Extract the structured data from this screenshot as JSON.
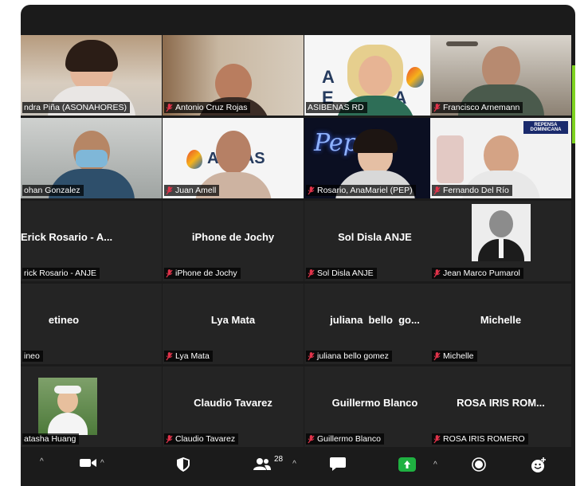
{
  "participants": [
    {
      "name": "ndra Piña (ASONAHORES)",
      "center": "",
      "video": true
    },
    {
      "name": "Antonio Cruz Rojas",
      "center": "",
      "video": true
    },
    {
      "name": "ASIBENAS RD",
      "center": "",
      "video": true
    },
    {
      "name": "Francisco Arnemann",
      "center": "",
      "video": true
    },
    {
      "name": "ohan Gonzalez",
      "center": "",
      "video": true
    },
    {
      "name": "Juan Amell",
      "center": "",
      "video": true
    },
    {
      "name": "Rosario, AnaMariel (PEP)",
      "center": "",
      "video": true
    },
    {
      "name": "Fernando Del Río",
      "center": "",
      "video": true
    },
    {
      "name": "rick Rosario - ANJE",
      "center": "Erick Rosario - A...",
      "video": false
    },
    {
      "name": "iPhone de Jochy",
      "center": "iPhone de Jochy",
      "video": false
    },
    {
      "name": "Sol Disla ANJE",
      "center": "Sol Disla ANJE",
      "video": false
    },
    {
      "name": "Jean Marco Pumarol",
      "center": "",
      "video": false
    },
    {
      "name": "ineo",
      "center": "etineo",
      "video": false
    },
    {
      "name": "Lya Mata",
      "center": "Lya Mata",
      "video": false
    },
    {
      "name": "juliana bello gomez",
      "center": "juliana  bello  go...",
      "video": false
    },
    {
      "name": "Michelle",
      "center": "Michelle",
      "video": false
    },
    {
      "name": "atasha Huang",
      "center": "",
      "video": false
    },
    {
      "name": "Claudio Tavarez",
      "center": "Claudio Tavarez",
      "video": false
    },
    {
      "name": "Guillermo Blanco",
      "center": "Guillermo Blanco",
      "video": false
    },
    {
      "name": "ROSA IRIS ROMERO",
      "center": "ROSA IRIS ROM...",
      "video": false
    }
  ],
  "backdrops": {
    "asibenas": "ASI ENA",
    "juan": "A   NAS",
    "pepsi": "Pepsi",
    "fernando_banner": "REPENSA DOMINICANA"
  },
  "toolbar": {
    "participant_count": "28"
  },
  "colors": {
    "accent_green": "#1fb141",
    "muted_red": "#e0334a"
  }
}
